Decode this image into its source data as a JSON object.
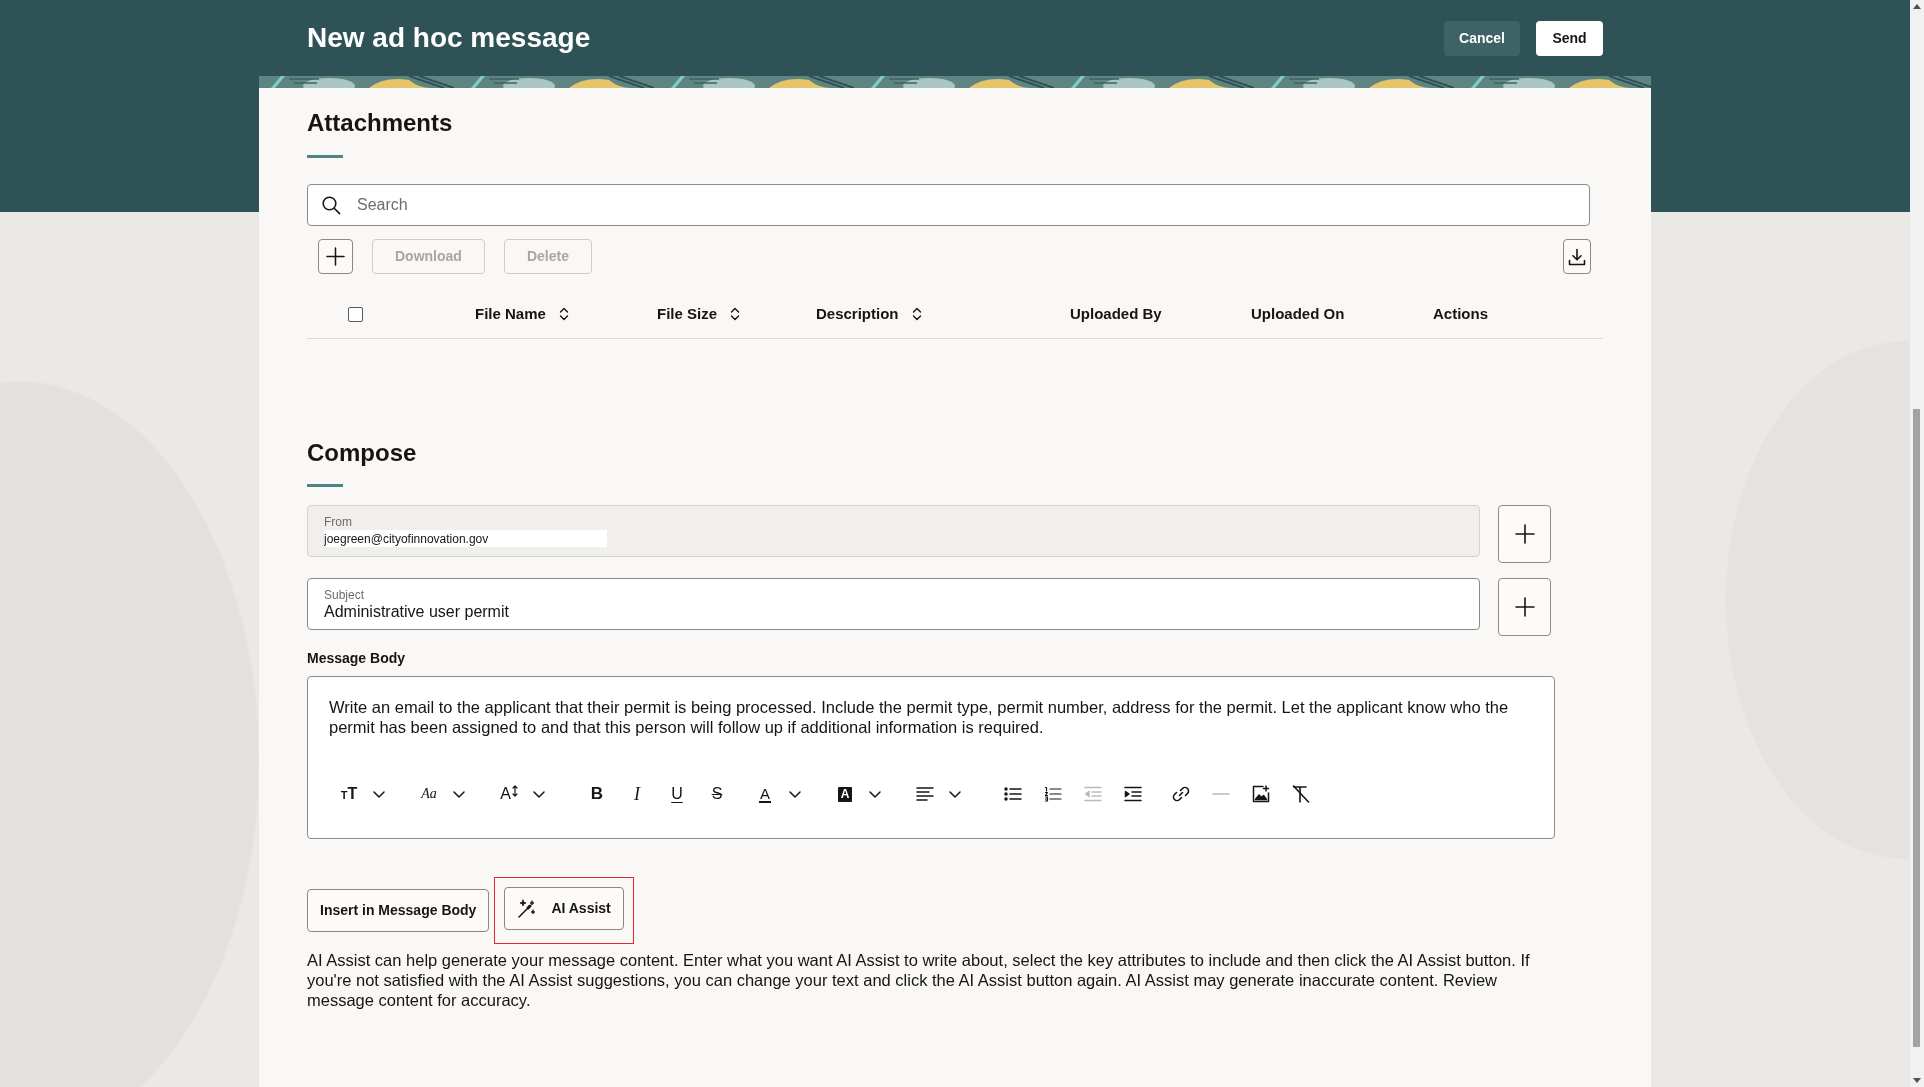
{
  "header": {
    "title": "New ad hoc message",
    "buttons": [
      {
        "label": "Cancel",
        "kind": "secondary"
      },
      {
        "label": "Send",
        "kind": "primary"
      }
    ]
  },
  "attachments": {
    "heading": "Attachments",
    "search": {
      "placeholder": "Search"
    },
    "toolbar": [
      {
        "kind": "add",
        "disabled": false
      },
      {
        "kind": "text",
        "label": "Download",
        "disabled": true
      },
      {
        "kind": "text",
        "label": "Delete",
        "disabled": true
      }
    ],
    "select_all": {
      "checked": false
    },
    "columns": [
      {
        "label": "File Name",
        "sortable": true
      },
      {
        "label": "File Size",
        "sortable": true
      },
      {
        "label": "Description",
        "sortable": true
      },
      {
        "label": "Uploaded By",
        "sortable": false
      },
      {
        "label": "Uploaded On",
        "sortable": false
      },
      {
        "label": "Actions",
        "sortable": false
      }
    ]
  },
  "compose": {
    "heading": "Compose",
    "fields": [
      {
        "label": "From",
        "value": "joegreen@cityofinnovation.gov",
        "disabled": true
      },
      {
        "label": "Subject",
        "value": "Administrative user permit",
        "disabled": false
      }
    ],
    "editor": {
      "label": "Message Body",
      "text": "Write an email to the applicant that their permit is being processed. Include the permit type, permit number, address for the permit. Let the applicant know who the permit has been assigned to and that this person will follow up if additional information is required.",
      "toolbar": [
        {
          "kind": "text-size",
          "glyph": "TT",
          "dropdown": true,
          "disabled": false
        },
        {
          "kind": "font",
          "glyph": "Aa",
          "dropdown": true,
          "disabled": false
        },
        {
          "kind": "font-size",
          "glyph": "A",
          "dropdown": true,
          "disabled": false
        },
        {
          "kind": "bold",
          "glyph": "B",
          "dropdown": false,
          "disabled": false
        },
        {
          "kind": "italic",
          "glyph": "I",
          "dropdown": false,
          "disabled": false
        },
        {
          "kind": "underline",
          "glyph": "U",
          "dropdown": false,
          "disabled": false
        },
        {
          "kind": "strike",
          "glyph": "S",
          "dropdown": false,
          "disabled": false
        },
        {
          "kind": "font-color",
          "glyph": "A",
          "dropdown": true,
          "disabled": false
        },
        {
          "kind": "highlight",
          "glyph": "A",
          "dropdown": true,
          "disabled": false
        },
        {
          "kind": "align",
          "dropdown": true,
          "disabled": false
        },
        {
          "kind": "bullets",
          "dropdown": false,
          "disabled": false
        },
        {
          "kind": "numbers",
          "dropdown": false,
          "disabled": false
        },
        {
          "kind": "outdent",
          "dropdown": false,
          "disabled": true
        },
        {
          "kind": "indent",
          "dropdown": false,
          "disabled": false
        },
        {
          "kind": "link",
          "dropdown": false,
          "disabled": false
        },
        {
          "kind": "rule",
          "dropdown": false,
          "disabled": true
        },
        {
          "kind": "image",
          "dropdown": false,
          "disabled": false
        },
        {
          "kind": "clear",
          "dropdown": false,
          "disabled": false
        }
      ]
    },
    "actions": [
      {
        "label": "Insert in Message Body",
        "kind": "text",
        "highlighted": false
      },
      {
        "label": "AI Assist",
        "kind": "ai",
        "highlighted": true
      }
    ],
    "help_text": "AI Assist can help generate your message content. Enter what you want AI Assist to write about, select the key attributes to include and then click the AI Assist button. If you're not satisfied with the AI Assist suggestions, you can change your text and click the AI Assist button again. AI Assist may generate inaccurate content. Review message content for accuracy."
  }
}
